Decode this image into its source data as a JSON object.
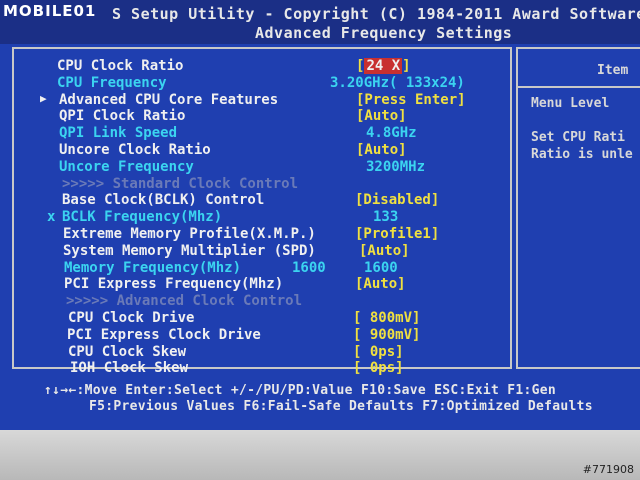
{
  "header": {
    "line1": "S Setup Utility - Copyright (C) 1984-2011 Award Software",
    "line2": "Advanced Frequency Settings",
    "logo": "MOBILE01"
  },
  "settings": [
    {
      "label": "CPU Clock Ratio",
      "value": "24 X",
      "label_color": "white",
      "selected": true
    },
    {
      "label": "CPU Frequency",
      "value": "3.20GHz( 133x24)",
      "label_color": "cyan"
    },
    {
      "marker": "▶",
      "label": "Advanced CPU Core Features",
      "value": "[Press Enter]",
      "label_color": "white"
    },
    {
      "label": "QPI Clock Ratio",
      "value": "[Auto]",
      "label_color": "white"
    },
    {
      "label": "QPI Link Speed",
      "value": "4.8GHz",
      "label_color": "cyan"
    },
    {
      "label": "Uncore Clock Ratio",
      "value": "[Auto]",
      "label_color": "white"
    },
    {
      "label": "Uncore Frequency",
      "value": "3200MHz",
      "label_color": "cyan"
    },
    {
      "label": ">>>>>  Standard Clock Control",
      "value": "",
      "label_color": "gray"
    },
    {
      "label": "Base Clock(BCLK) Control",
      "value": "[Disabled]",
      "label_color": "white"
    },
    {
      "marker": "x",
      "label": "BCLK Frequency(Mhz)",
      "value": "133",
      "label_color": "cyan"
    },
    {
      "label": "Extreme Memory Profile(X.M.P.)",
      "value": "[Profile1]",
      "label_color": "white"
    },
    {
      "label": "System Memory Multiplier (SPD)",
      "value": "[Auto]",
      "label_color": "white"
    },
    {
      "label": "Memory Frequency(Mhz)",
      "mid": "1600",
      "value": "1600",
      "label_color": "cyan"
    },
    {
      "label": "PCI Express Frequency(Mhz)",
      "value": "[Auto]",
      "label_color": "white"
    },
    {
      "label": ">>>>>  Advanced Clock Control",
      "value": "",
      "label_color": "gray"
    },
    {
      "label": "CPU Clock Drive",
      "value": "[ 800mV]",
      "label_color": "white"
    },
    {
      "label": "PCI Express Clock Drive",
      "value": "[ 900mV]",
      "label_color": "white"
    },
    {
      "label": "CPU Clock Skew",
      "value": "[    0ps]",
      "label_color": "white"
    },
    {
      "label": "IOH Clock Skew",
      "value": "[    0ps]",
      "label_color": "white"
    }
  ],
  "help": {
    "title": "Item",
    "level": "Menu Level",
    "line1": "Set CPU Rati",
    "line2": "Ratio is unle"
  },
  "footer": {
    "line1": "↑↓→←:Move  Enter:Select  +/-/PU/PD:Value  F10:Save  ESC:Exit  F1:Gen",
    "line2": "F5:Previous Values  F6:Fail-Safe Defaults  F7:Optimized Defaults"
  },
  "watermark": "#771908",
  "colors": {
    "background": "#1f3fb0",
    "white_text": "#f0f0f0",
    "cyan_text": "#3bd4f0",
    "yellow_value": "#f0e040",
    "gray_text": "#6a7ab8",
    "selection": "#c83030"
  }
}
